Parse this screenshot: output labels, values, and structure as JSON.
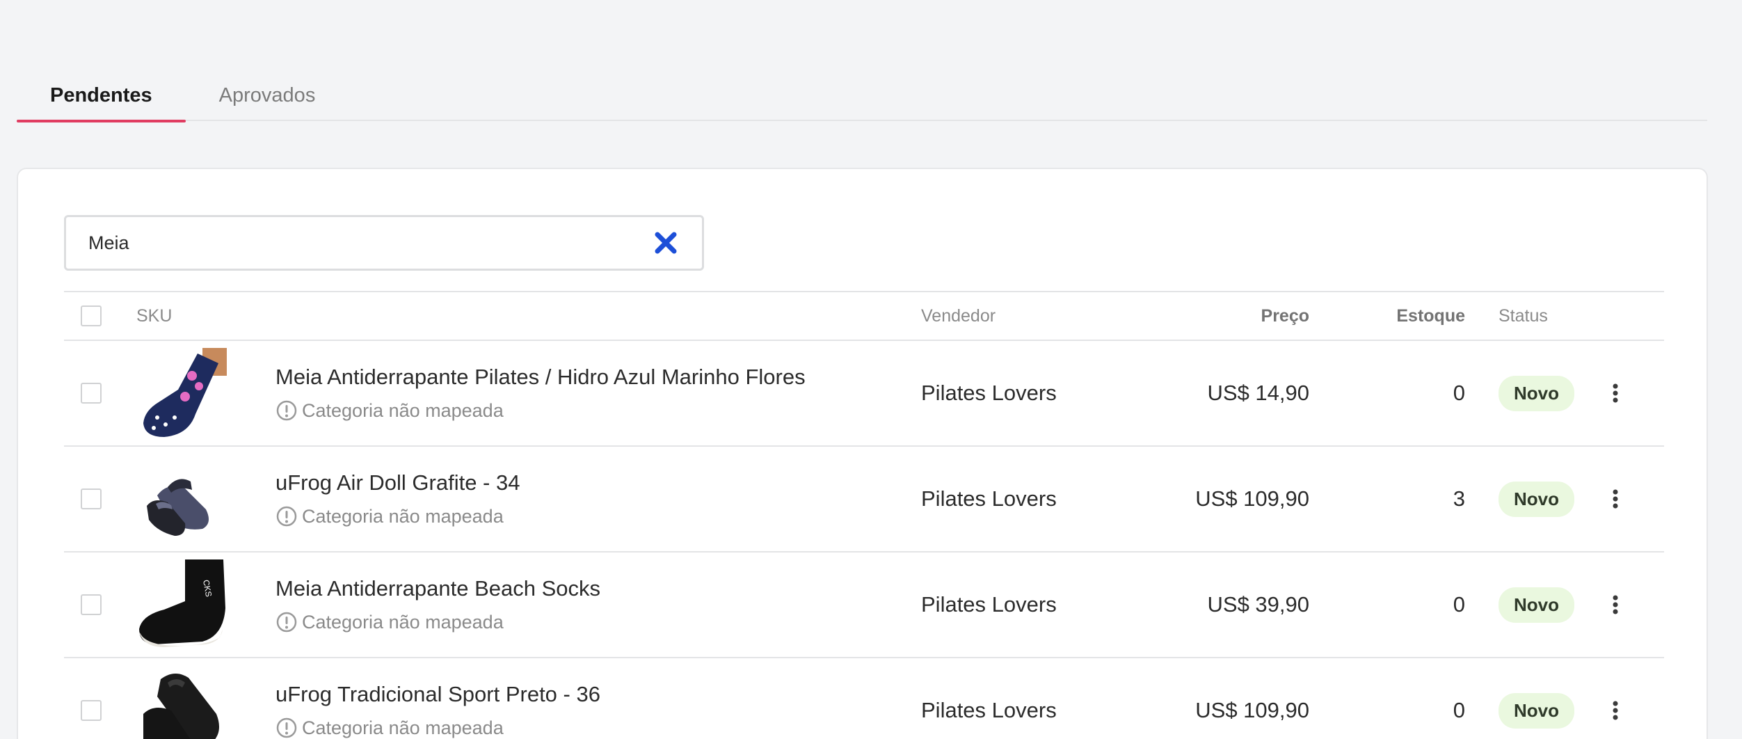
{
  "tabs": [
    {
      "label": "Pendentes",
      "active": true
    },
    {
      "label": "Aprovados",
      "active": false
    }
  ],
  "search": {
    "value": "Meia"
  },
  "table": {
    "headers": {
      "sku": "SKU",
      "vendor": "Vendedor",
      "price": "Preço",
      "stock": "Estoque",
      "status": "Status"
    },
    "rows": [
      {
        "name": "Meia Antiderrapante Pilates / Hidro Azul Marinho Flores",
        "warning": "Categoria não mapeada",
        "vendor": "Pilates Lovers",
        "price": "US$ 14,90",
        "stock": "0",
        "status": "Novo",
        "image": "navy-floral-sock"
      },
      {
        "name": "uFrog Air Doll Grafite - 34",
        "warning": "Categoria não mapeada",
        "vendor": "Pilates Lovers",
        "price": "US$ 109,90",
        "stock": "3",
        "status": "Novo",
        "image": "graphite-slip-shoe"
      },
      {
        "name": "Meia Antiderrapante Beach Socks",
        "warning": "Categoria não mapeada",
        "vendor": "Pilates Lovers",
        "price": "US$ 39,90",
        "stock": "0",
        "status": "Novo",
        "image": "black-beach-sock"
      },
      {
        "name": "uFrog Tradicional Sport Preto - 36",
        "warning": "Categoria não mapeada",
        "vendor": "Pilates Lovers",
        "price": "US$ 109,90",
        "stock": "0",
        "status": "Novo",
        "image": "black-sport-shoe"
      }
    ]
  },
  "colors": {
    "accent": "#e03c61",
    "clear_icon": "#1d4fd8",
    "badge_bg": "#eaf8df",
    "background": "#f3f4f6"
  }
}
